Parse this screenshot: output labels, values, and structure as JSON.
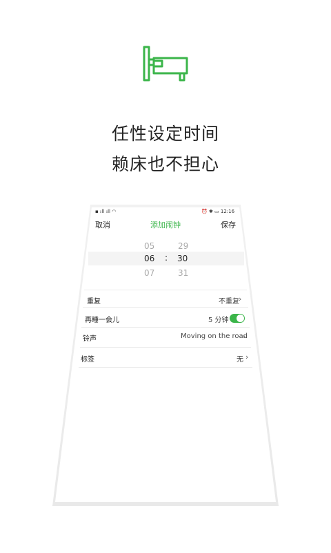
{
  "hero": {
    "icon": "bed-icon",
    "line1": "任性设定时间",
    "line2": "赖床也不担心"
  },
  "colors": {
    "accent": "#3bb54a",
    "text": "#222222"
  },
  "status_bar": {
    "left": "▪ ᵢᵢll ᵢᵢll ◠",
    "right": "⏰ ✱ ▭ 12:16"
  },
  "nav": {
    "cancel": "取消",
    "title": "添加闹钟",
    "save": "保存"
  },
  "picker": {
    "hours": [
      "05",
      "06",
      "07"
    ],
    "minutes": [
      "29",
      "30",
      "31"
    ],
    "separator": ":"
  },
  "settings": [
    {
      "label": "重复",
      "value": "不重复"
    },
    {
      "label": "再睡一会儿",
      "value": "5 分钟",
      "toggle_on": true
    },
    {
      "label": "铃声",
      "value": "Moving on the road"
    },
    {
      "label": "标签",
      "value": "无"
    }
  ]
}
